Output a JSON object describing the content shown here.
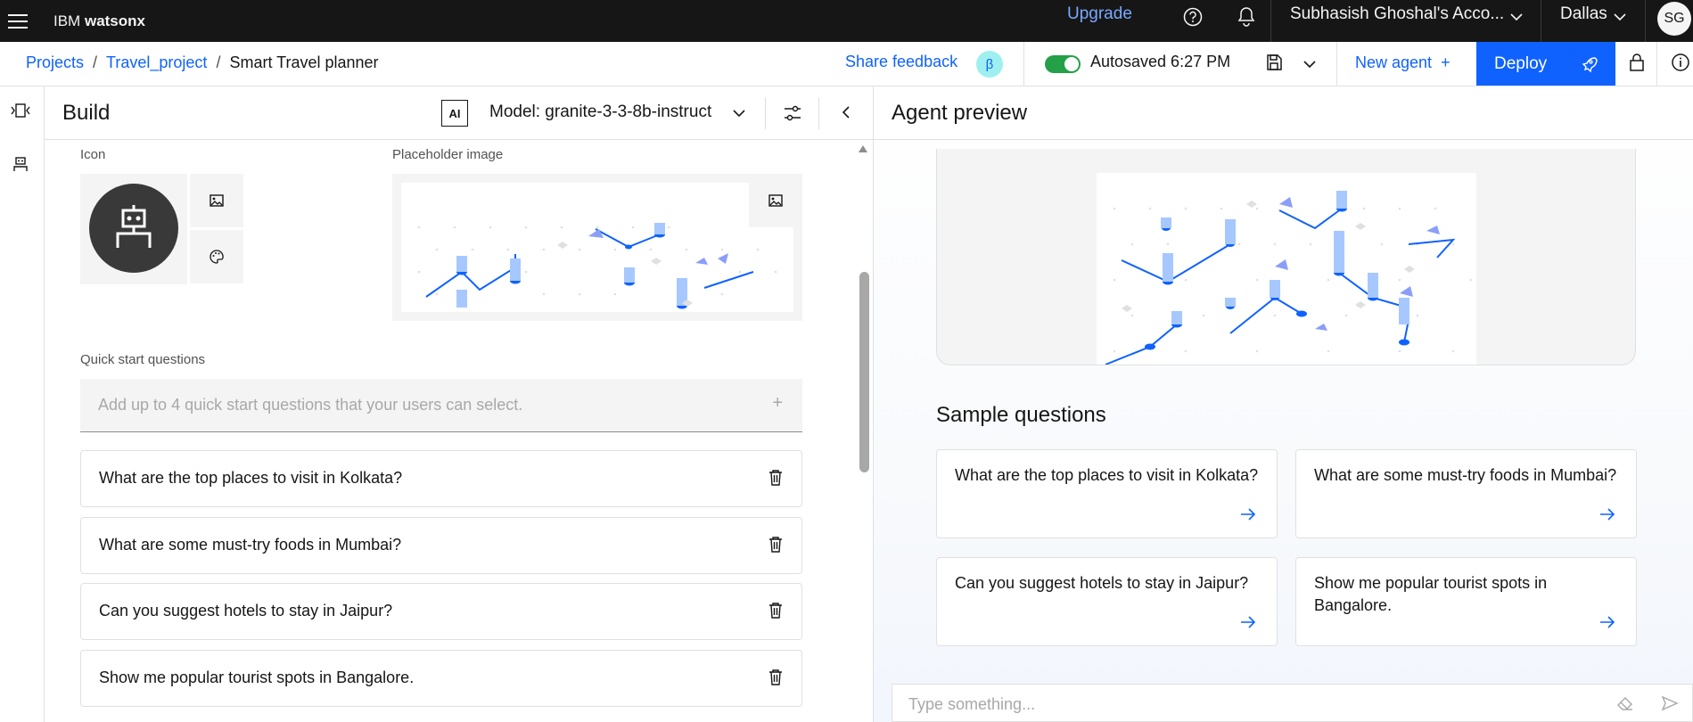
{
  "topbar": {
    "brand_prefix": "IBM",
    "brand_name": "watsonx",
    "upgrade": "Upgrade",
    "account": "Subhasish Ghoshal's Acco...",
    "region": "Dallas",
    "avatar": "SG"
  },
  "subbar": {
    "breadcrumbs": [
      "Projects",
      "Travel_project",
      "Smart Travel planner"
    ],
    "share_feedback": "Share feedback",
    "beta": "β",
    "autosaved": "Autosaved 6:27 PM",
    "new_agent": "New agent",
    "deploy": "Deploy"
  },
  "build": {
    "title": "Build",
    "ai_badge": "AI",
    "model": "Model: granite-3-3-8b-instruct",
    "icon_label": "Icon",
    "placeholder_label": "Placeholder image",
    "quick_start_label": "Quick start questions",
    "quick_start_placeholder": "Add up to 4 quick start questions that your users can select.",
    "questions": [
      "What are the top places to visit in Kolkata?",
      "What are some must-try foods in Mumbai?",
      "Can you suggest hotels to stay in Jaipur?",
      "Show me popular tourist spots in Bangalore."
    ]
  },
  "preview": {
    "title": "Agent preview",
    "sample_title": "Sample questions",
    "cards": [
      "What are the top places to visit in Kolkata?",
      "What are some must-try foods in Mumbai?",
      "Can you suggest hotels to stay in Jaipur?",
      "Show me popular tourist spots in Bangalore."
    ],
    "chat_placeholder": "Type something..."
  },
  "colors": {
    "accent": "#0f62fe",
    "topbar_bg": "#161616",
    "toggle_on": "#24a148"
  },
  "icons": [
    "menu-icon",
    "help-icon",
    "notification-icon",
    "chevron-down-icon",
    "save-icon",
    "plus-icon",
    "rocket-icon",
    "lock-icon",
    "info-icon",
    "robot-icon",
    "image-icon",
    "palette-icon",
    "settings-icon",
    "chevron-left-icon",
    "trash-icon",
    "arrow-right-icon",
    "eraser-icon",
    "send-icon"
  ]
}
